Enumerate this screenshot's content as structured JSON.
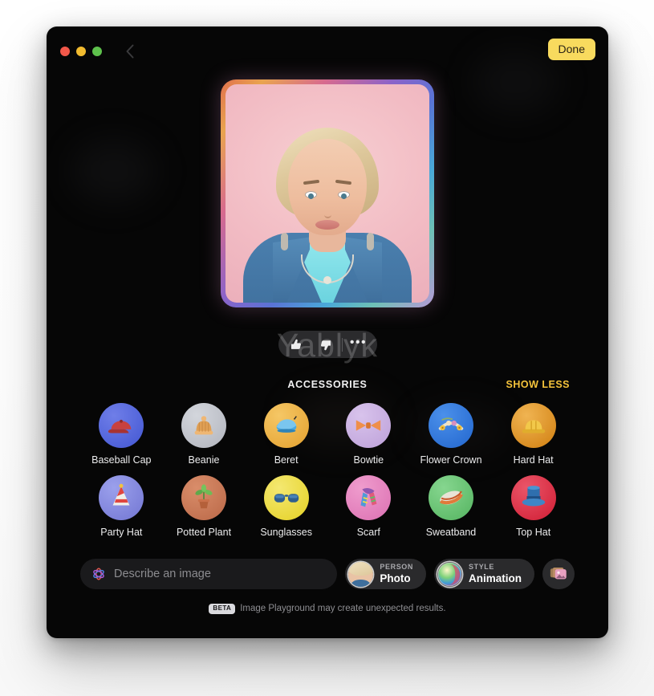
{
  "window": {
    "traffic_lights": [
      {
        "name": "close",
        "color": "#f2584a"
      },
      {
        "name": "minimize",
        "color": "#f1bb2f"
      },
      {
        "name": "maximize",
        "color": "#5ec14c"
      }
    ],
    "back_icon": "chevron-left-icon",
    "done_label": "Done",
    "done_color": "#f8da5e"
  },
  "preview": {
    "watermark": "Yablyk",
    "image_alt": "Generated animation-style portrait of a blonde woman in a blue blazer",
    "feedback": {
      "thumbs_up_icon": "thumbs-up-icon",
      "thumbs_down_icon": "thumbs-down-icon",
      "more_label": "•••"
    }
  },
  "accessories": {
    "title": "ACCESSORIES",
    "show_less_label": "SHOW LESS",
    "show_less_color": "#f5c33b",
    "items": [
      {
        "label": "Baseball Cap",
        "icon": "baseball-cap-icon",
        "bg": "#4c5fd7",
        "bg2": "#6f7ee8"
      },
      {
        "label": "Beanie",
        "icon": "beanie-icon",
        "bg": "#b9bcc4",
        "bg2": "#d3d6dc"
      },
      {
        "label": "Beret",
        "icon": "beret-icon",
        "bg": "#e8a93a",
        "bg2": "#f5c766"
      },
      {
        "label": "Bowtie",
        "icon": "bowtie-icon",
        "bg": "#c3a8dd",
        "bg2": "#d8c3ec"
      },
      {
        "label": "Flower Crown",
        "icon": "flower-crown-icon",
        "bg": "#2b6fd4",
        "bg2": "#4b90ea"
      },
      {
        "label": "Hard Hat",
        "icon": "hard-hat-icon",
        "bg": "#d78a1e",
        "bg2": "#f0b452"
      },
      {
        "label": "Party Hat",
        "icon": "party-hat-icon",
        "bg": "#7b7fd8",
        "bg2": "#9ba0ec"
      },
      {
        "label": "Potted Plant",
        "icon": "potted-plant-icon",
        "bg": "#c1704f",
        "bg2": "#d98d6a"
      },
      {
        "label": "Sunglasses",
        "icon": "sunglasses-icon",
        "bg": "#e8d635",
        "bg2": "#f4e871"
      },
      {
        "label": "Scarf",
        "icon": "scarf-icon",
        "bg": "#e07ab8",
        "bg2": "#ef9ccd"
      },
      {
        "label": "Sweatband",
        "icon": "sweatband-icon",
        "bg": "#5fbb6a",
        "bg2": "#86d68f"
      },
      {
        "label": "Top Hat",
        "icon": "top-hat-icon",
        "bg": "#d6293f",
        "bg2": "#ea5568"
      }
    ]
  },
  "toolbar": {
    "prompt_icon": "apple-intelligence-icon",
    "prompt_placeholder": "Describe an image",
    "prompt_value": "",
    "person_chip": {
      "kicker": "PERSON",
      "value": "Photo",
      "thumb": "person-avatar"
    },
    "style_chip": {
      "kicker": "STYLE",
      "value": "Animation",
      "thumb": "style-sphere-icon"
    },
    "photo_picker_icon": "photo-stack-icon"
  },
  "footer": {
    "badge": "BETA",
    "text": "Image Playground may create unexpected results."
  }
}
